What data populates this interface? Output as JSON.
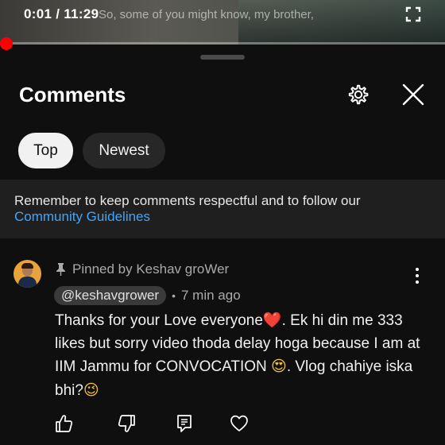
{
  "player": {
    "time": "0:01 / 11:29",
    "caption": "So, some of you might know, my brother,",
    "progress": 0.0015,
    "icons": {
      "fullscreen": "fullscreen-icon"
    }
  },
  "comments_panel": {
    "title": "Comments",
    "icons": {
      "settings": "gear-icon",
      "close": "close-icon"
    },
    "filters": [
      {
        "label": "Top",
        "selected": true
      },
      {
        "label": "Newest",
        "selected": false
      }
    ],
    "notice": {
      "text": "Remember to keep comments respectful and to follow our",
      "link": "Community Guidelines"
    }
  },
  "comment": {
    "pinned_label": "Pinned by Keshav groWer",
    "author_handle": "@keshavgrower",
    "separator": "•",
    "time_ago": "7 min ago",
    "text_parts": {
      "p1": "Thanks for your Love everyone",
      "heart": "❤️",
      "p2": ". Ek hi din me 333 likes but sorry video thoda delay hoga because I am at IIM Jammu for CONVOCATION ",
      "heart_eyes": "😍",
      "p3": ". Vlog chahiye iska bhi?",
      "wink": "😉"
    },
    "icons": {
      "like": "thumbs-up-icon",
      "dislike": "thumbs-down-icon",
      "reply": "reply-icon",
      "heart": "heart-icon",
      "pin": "pin-icon",
      "more": "more-vertical-icon"
    }
  },
  "colors": {
    "background": "#0f0f0f",
    "link": "#3ea6ff",
    "progress": "#ff0000",
    "chip_selected": "#f1f1f1",
    "chip_unselected": "#272727"
  }
}
